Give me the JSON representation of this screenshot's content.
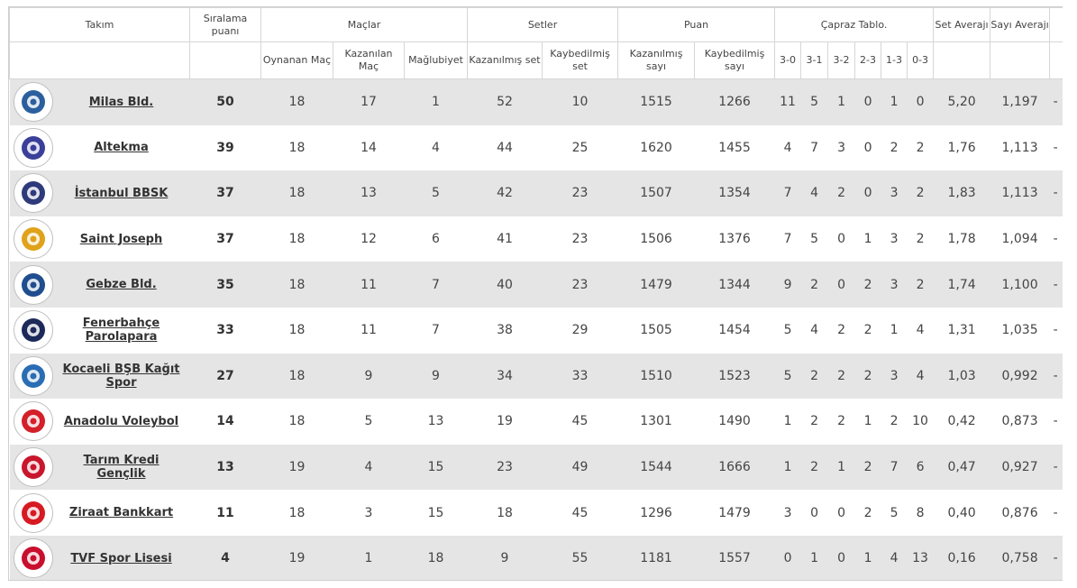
{
  "headers": {
    "team": "Takım",
    "rank_points": "Sıralama puanı",
    "matches": "Maçlar",
    "sets": "Setler",
    "points": "Puan",
    "cross": "Çapraz Tablo.",
    "set_avg": "Set Averajı",
    "point_avg": "Sayı Averajı",
    "played": "Oynanan Maç",
    "won": "Kazanılan Maç",
    "lost": "Mağlubiyet",
    "sets_won": "Kazanılmış set",
    "sets_lost": "Kaybedilmiş set",
    "points_won": "Kazanılmış sayı",
    "points_lost": "Kaybedilmiş sayı",
    "c30": "3-0",
    "c31": "3-1",
    "c32": "3-2",
    "c23": "2-3",
    "c13": "1-3",
    "c03": "0-3"
  },
  "rows": [
    {
      "name": "Milas Bld.",
      "pts": "50",
      "played": "18",
      "won": "17",
      "lost": "1",
      "sw": "52",
      "sl": "10",
      "pw": "1515",
      "pl": "1266",
      "c30": "11",
      "c31": "5",
      "c32": "1",
      "c23": "0",
      "c13": "1",
      "c03": "0",
      "setavg": "5,20",
      "ptavg": "1,197",
      "extra": "-",
      "logo": "milas-logo-icon",
      "color": "#2b5f9e"
    },
    {
      "name": "Altekma",
      "pts": "39",
      "played": "18",
      "won": "14",
      "lost": "4",
      "sw": "44",
      "sl": "25",
      "pw": "1620",
      "pl": "1455",
      "c30": "4",
      "c31": "7",
      "c32": "3",
      "c23": "0",
      "c13": "2",
      "c03": "2",
      "setavg": "1,76",
      "ptavg": "1,113",
      "extra": "-",
      "logo": "altekma-logo-icon",
      "color": "#3a3f9a"
    },
    {
      "name": "İstanbul BBSK",
      "pts": "37",
      "played": "18",
      "won": "13",
      "lost": "5",
      "sw": "42",
      "sl": "23",
      "pw": "1507",
      "pl": "1354",
      "c30": "7",
      "c31": "4",
      "c32": "2",
      "c23": "0",
      "c13": "3",
      "c03": "2",
      "setavg": "1,83",
      "ptavg": "1,113",
      "extra": "-",
      "logo": "ibb-logo-icon",
      "color": "#2e3a7a"
    },
    {
      "name": "Saint Joseph",
      "pts": "37",
      "played": "18",
      "won": "12",
      "lost": "6",
      "sw": "41",
      "sl": "23",
      "pw": "1506",
      "pl": "1376",
      "c30": "7",
      "c31": "5",
      "c32": "0",
      "c23": "1",
      "c13": "3",
      "c03": "2",
      "setavg": "1,78",
      "ptavg": "1,094",
      "extra": "-",
      "logo": "saint-joseph-logo-icon",
      "color": "#e0a21a"
    },
    {
      "name": "Gebze Bld.",
      "pts": "35",
      "played": "18",
      "won": "11",
      "lost": "7",
      "sw": "40",
      "sl": "23",
      "pw": "1479",
      "pl": "1344",
      "c30": "9",
      "c31": "2",
      "c32": "0",
      "c23": "2",
      "c13": "3",
      "c03": "2",
      "setavg": "1,74",
      "ptavg": "1,100",
      "extra": "-",
      "logo": "gebze-logo-icon",
      "color": "#1f4d8f"
    },
    {
      "name": "Fenerbahçe Parolapara",
      "pts": "33",
      "played": "18",
      "won": "11",
      "lost": "7",
      "sw": "38",
      "sl": "29",
      "pw": "1505",
      "pl": "1454",
      "c30": "5",
      "c31": "4",
      "c32": "2",
      "c23": "2",
      "c13": "1",
      "c03": "4",
      "setavg": "1,31",
      "ptavg": "1,035",
      "extra": "-",
      "logo": "fenerbahce-logo-icon",
      "color": "#1c2a5a"
    },
    {
      "name": "Kocaeli BŞB Kağıt Spor",
      "pts": "27",
      "played": "18",
      "won": "9",
      "lost": "9",
      "sw": "34",
      "sl": "33",
      "pw": "1510",
      "pl": "1523",
      "c30": "5",
      "c31": "2",
      "c32": "2",
      "c23": "2",
      "c13": "3",
      "c03": "4",
      "setavg": "1,03",
      "ptavg": "0,992",
      "extra": "-",
      "logo": "kocaeli-logo-icon",
      "color": "#2a6db3"
    },
    {
      "name": "Anadolu Voleybol",
      "pts": "14",
      "played": "18",
      "won": "5",
      "lost": "13",
      "sw": "19",
      "sl": "45",
      "pw": "1301",
      "pl": "1490",
      "c30": "1",
      "c31": "2",
      "c32": "2",
      "c23": "1",
      "c13": "2",
      "c03": "10",
      "setavg": "0,42",
      "ptavg": "0,873",
      "extra": "-",
      "logo": "anadolu-logo-icon",
      "color": "#d3202a"
    },
    {
      "name": "Tarım Kredi Gençlik",
      "pts": "13",
      "played": "19",
      "won": "4",
      "lost": "15",
      "sw": "23",
      "sl": "49",
      "pw": "1544",
      "pl": "1666",
      "c30": "1",
      "c31": "2",
      "c32": "1",
      "c23": "2",
      "c13": "7",
      "c03": "6",
      "setavg": "0,47",
      "ptavg": "0,927",
      "extra": "-",
      "logo": "tarim-kredi-logo-icon",
      "color": "#c8172c"
    },
    {
      "name": "Ziraat Bankkart",
      "pts": "11",
      "played": "18",
      "won": "3",
      "lost": "15",
      "sw": "18",
      "sl": "45",
      "pw": "1296",
      "pl": "1479",
      "c30": "3",
      "c31": "0",
      "c32": "0",
      "c23": "2",
      "c13": "5",
      "c03": "8",
      "setavg": "0,40",
      "ptavg": "0,876",
      "extra": "-",
      "logo": "ziraat-logo-icon",
      "color": "#d71921"
    },
    {
      "name": "TVF Spor Lisesi",
      "pts": "4",
      "played": "19",
      "won": "1",
      "lost": "18",
      "sw": "9",
      "sl": "55",
      "pw": "1181",
      "pl": "1557",
      "c30": "0",
      "c31": "1",
      "c32": "0",
      "c23": "1",
      "c13": "4",
      "c03": "13",
      "setavg": "0,16",
      "ptavg": "0,758",
      "extra": "-",
      "logo": "tvf-logo-icon",
      "color": "#c8102e"
    }
  ]
}
